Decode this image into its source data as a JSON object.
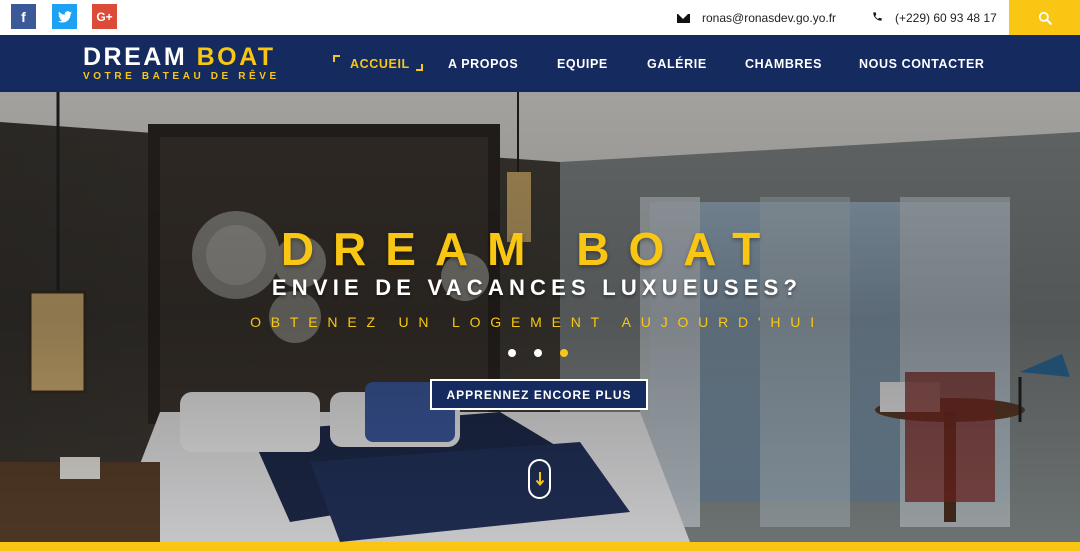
{
  "topbar": {
    "social": [
      {
        "name": "facebook",
        "glyph": "f"
      },
      {
        "name": "twitter",
        "glyph": "t"
      },
      {
        "name": "google-plus",
        "glyph": "G+"
      }
    ],
    "email": "ronas@ronasdev.go.yo.fr",
    "phone": "(+229) 60 93 48 17"
  },
  "brand": {
    "title_main": "DREAM ",
    "title_accent": "BOAT",
    "subtitle": "VOTRE BATEAU DE RÊVE"
  },
  "nav": {
    "items": [
      {
        "label": "ACCUEIL",
        "active": true
      },
      {
        "label": "A PROPOS",
        "active": false
      },
      {
        "label": "EQUIPE",
        "active": false
      },
      {
        "label": "GALÉRIE",
        "active": false
      },
      {
        "label": "CHAMBRES",
        "active": false
      },
      {
        "label": "NOUS CONTACTER",
        "active": false
      }
    ]
  },
  "hero": {
    "title": "DREAM BOAT",
    "subtitle": "ENVIE DE VACANCES LUXUEUSES?",
    "tagline": "OBTENEZ UN LOGEMENT AUJOURD'HUI",
    "cta_label": "APPRENNEZ ENCORE PLUS",
    "slides_total": 3,
    "slide_active": 3
  },
  "colors": {
    "accent": "#f9c713",
    "navy": "#152a5e",
    "facebook": "#3b5998",
    "twitter": "#1da1f2",
    "google_plus": "#dc4a38"
  },
  "icons": {
    "email": "envelope-icon",
    "phone": "phone-icon",
    "search": "search-icon",
    "scroll": "arrow-down-icon"
  }
}
